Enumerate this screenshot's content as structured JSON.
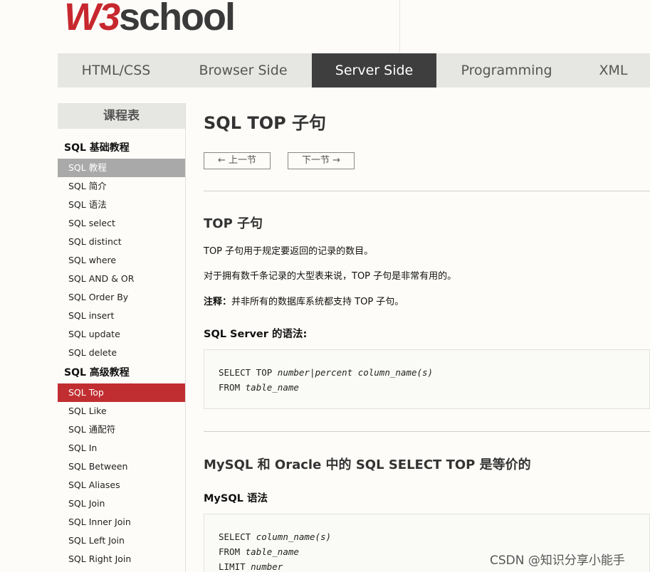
{
  "logo": {
    "w3": "W3",
    "school": "school"
  },
  "nav": {
    "items": [
      {
        "label": "HTML/CSS"
      },
      {
        "label": "Browser Side"
      },
      {
        "label": "Server Side"
      },
      {
        "label": "Programming"
      },
      {
        "label": "XML"
      }
    ],
    "active": "Server Side"
  },
  "sidebar": {
    "title": "课程表",
    "section1": "SQL 基础教程",
    "basics": [
      "SQL 教程",
      "SQL 简介",
      "SQL 语法",
      "SQL select",
      "SQL distinct",
      "SQL where",
      "SQL AND & OR",
      "SQL Order By",
      "SQL insert",
      "SQL update",
      "SQL delete"
    ],
    "section2": "SQL 高级教程",
    "advanced": [
      "SQL Top",
      "SQL Like",
      "SQL 通配符",
      "SQL In",
      "SQL Between",
      "SQL Aliases",
      "SQL Join",
      "SQL Inner Join",
      "SQL Left Join",
      "SQL Right Join"
    ]
  },
  "main": {
    "title": "SQL TOP 子句",
    "prev": "上一节",
    "next": "下一节",
    "section1": {
      "heading": "TOP 子句",
      "p1": "TOP 子句用于规定要返回的记录的数目。",
      "p2": "对于拥有数千条记录的大型表来说，TOP 子句是非常有用的。",
      "note_label": "注释：",
      "note_text": "并非所有的数据库系统都支持 TOP 子句。",
      "syntax_heading": "SQL Server 的语法:",
      "code": {
        "l1_kw": "SELECT TOP ",
        "l1_arg1": "number",
        "l1_sep": "|",
        "l1_arg2": "percent column_name(s)",
        "l2_kw": "FROM ",
        "l2_arg": "table_name"
      }
    },
    "section2": {
      "heading": "MySQL 和 Oracle 中的 SQL SELECT TOP 是等价的",
      "syntax_heading": "MySQL 语法",
      "code": {
        "l1_kw": "SELECT ",
        "l1_arg": "column_name(s)",
        "l2_kw": "FROM ",
        "l2_arg": "table_name",
        "l3_kw": "LIMIT ",
        "l3_arg": "number"
      }
    }
  },
  "watermark": "CSDN @知识分享小能手"
}
